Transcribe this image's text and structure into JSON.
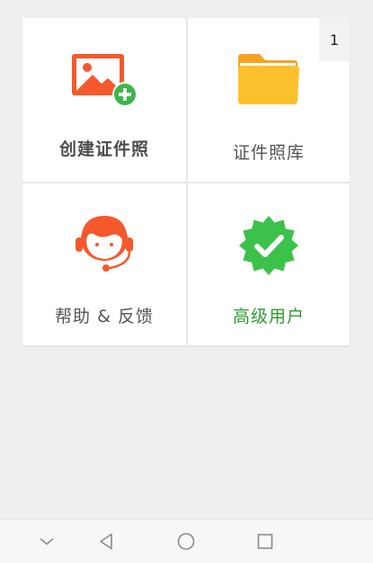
{
  "tiles": [
    {
      "label": "创建证件照",
      "icon": "add-photo-icon"
    },
    {
      "label": "证件照库",
      "icon": "folder-icon",
      "badge": "1"
    },
    {
      "label": "帮助 & 反馈",
      "icon": "support-headset-icon"
    },
    {
      "label": "高级用户",
      "icon": "verified-badge-icon"
    }
  ],
  "colors": {
    "orange": "#f4592b",
    "green": "#3cb54a",
    "folder": "#fbc02d",
    "premium_text": "#2e9a2e"
  },
  "navbar": {
    "icons": [
      "chevron-down-icon",
      "back-triangle-icon",
      "home-circle-icon",
      "recent-square-icon"
    ]
  }
}
